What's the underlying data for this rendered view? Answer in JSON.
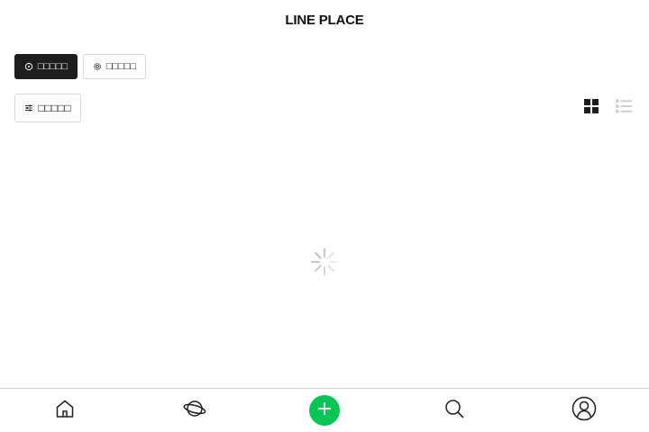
{
  "header": {
    "title": "LINE PLACE"
  },
  "chips": [
    {
      "label": "□□□□□",
      "icon": "location-target-icon",
      "active": true
    },
    {
      "label": "□□□□□",
      "icon": "gear-icon",
      "active": false
    }
  ],
  "filter": {
    "label": "□□□□□",
    "icon": "sliders-icon"
  },
  "view": {
    "selected": "grid",
    "grid_icon": "grid-view-icon",
    "list_icon": "list-view-icon"
  },
  "main": {
    "state": "loading",
    "spinner_icon": "loading-spinner-icon"
  },
  "tabbar": {
    "items": [
      {
        "icon": "home-icon"
      },
      {
        "icon": "planet-icon"
      },
      {
        "icon": "plus-icon",
        "accent": "#06c755"
      },
      {
        "icon": "search-icon"
      },
      {
        "icon": "profile-icon"
      }
    ]
  },
  "colors": {
    "accent": "#06c755",
    "chip_active_bg": "#1e1e1e",
    "border": "#d8d8d8",
    "icon_inactive": "#cfcfcf"
  }
}
